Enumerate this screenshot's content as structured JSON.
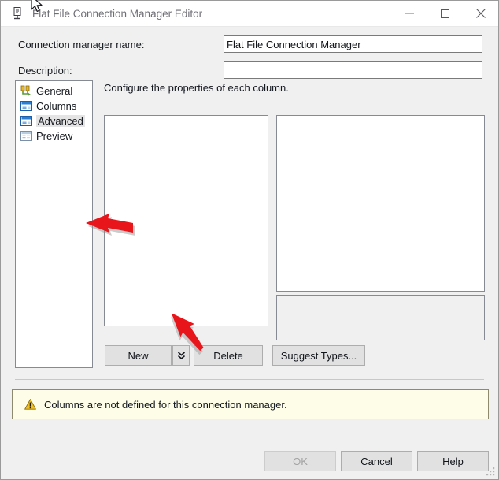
{
  "window": {
    "title": "Flat File Connection Manager Editor",
    "icon": "flat-file-connection-icon",
    "caption_buttons": {
      "minimize": "—",
      "maximize": "□",
      "close": "✕"
    }
  },
  "fields": {
    "connection_name": {
      "label": "Connection manager name:",
      "value": "Flat File Connection Manager",
      "placeholder": ""
    },
    "description": {
      "label": "Description:",
      "value": "",
      "placeholder": ""
    }
  },
  "sidebar": {
    "items": [
      {
        "label": "General",
        "icon": "general-plug-icon",
        "selected": false
      },
      {
        "label": "Columns",
        "icon": "columns-grid-icon",
        "selected": false
      },
      {
        "label": "Advanced",
        "icon": "advanced-grid-icon",
        "selected": true
      },
      {
        "label": "Preview",
        "icon": "preview-grid-icon",
        "selected": false
      }
    ]
  },
  "main": {
    "pane_title": "Configure the properties of each column.",
    "columns_list_items": [],
    "property_grid_rows": [],
    "property_description": ""
  },
  "actions": {
    "new_label": "New",
    "new_dropdown_glyph": "↓",
    "delete_label": "Delete",
    "suggest_types_label": "Suggest Types..."
  },
  "warning": {
    "icon": "warning-triangle-icon",
    "text": "Columns are not defined for this connection manager."
  },
  "footer": {
    "ok_label": "OK",
    "ok_enabled": false,
    "cancel_label": "Cancel",
    "help_label": "Help",
    "resize_grip": "resize-grip-icon"
  },
  "annotations": {
    "arrow_to_advanced": "red-arrow-pointing-left",
    "arrow_to_new_button": "red-arrow-pointing-down-left",
    "mouse_cursor": "mouse-pointer-cursor"
  },
  "colors": {
    "window_bg": "#f0f0f0",
    "accent_warning_bg": "#fefde8",
    "annotation_red": "#e8151b",
    "selection_highlight": "#e4e4e4"
  }
}
